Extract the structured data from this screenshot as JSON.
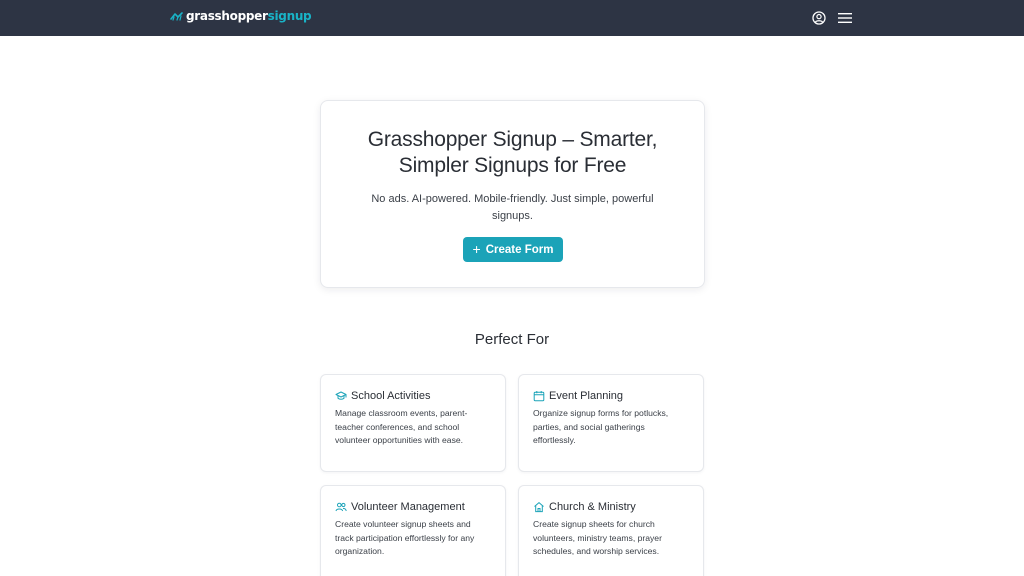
{
  "header": {
    "logo_main": "grasshopper",
    "logo_accent": "signup",
    "user_icon": "user-circle-icon",
    "menu_icon": "hamburger-menu-icon",
    "colors": {
      "bar": "#2d3444",
      "accent": "#19b3c7"
    }
  },
  "hero": {
    "title_line1": "Grasshopper Signup – Smarter,",
    "title_line2": "Simpler Signups for Free",
    "subtitle_line1": "No ads. AI-powered. Mobile-friendly. Just simple, powerful",
    "subtitle_line2": "signups.",
    "cta_label": "Create Form",
    "cta_icon": "plus-icon",
    "cta_color": "#1ba3b8"
  },
  "section": {
    "title": "Perfect For",
    "features": [
      {
        "icon": "graduation-cap-icon",
        "title": "School Activities",
        "desc_lines": [
          "Manage classroom events, parent-",
          "teacher conferences, and school",
          "volunteer opportunities with ease."
        ]
      },
      {
        "icon": "calendar-icon",
        "title": "Event Planning",
        "desc_lines": [
          "Organize signup forms for potlucks,",
          "parties, and social gatherings",
          "effortlessly."
        ]
      },
      {
        "icon": "users-icon",
        "title": "Volunteer Management",
        "desc_lines": [
          "Create volunteer signup sheets and",
          "track participation effortlessly for any",
          "organization."
        ]
      },
      {
        "icon": "home-icon",
        "title": "Church & Ministry",
        "desc_lines": [
          "Create signup sheets for church",
          "volunteers, ministry teams, prayer",
          "schedules, and worship services."
        ]
      }
    ]
  }
}
